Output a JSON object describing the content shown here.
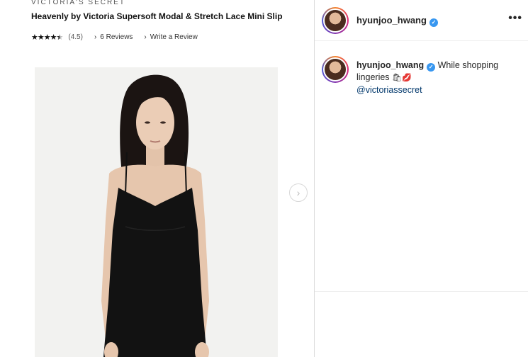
{
  "product": {
    "brand": "VICTORIA'S SECRET",
    "title": "Heavenly by Victoria Supersoft Modal & Stretch Lace Mini Slip",
    "rating": 4.5,
    "rating_text": "(4.5)",
    "reviews_link": "6 Reviews",
    "write_review_link": "Write a Review"
  },
  "post": {
    "header_username": "hyunjoo_hwang",
    "more_label": "•••",
    "caption_username": "hyunjoo_hwang",
    "caption_text": "While shopping lingeries",
    "caption_emoji": "🛍💋",
    "mention": "@victoriassecret"
  },
  "icons": {
    "next": "chevron-right-icon",
    "verified": "verified-badge-icon",
    "star": "star-icon"
  },
  "colors": {
    "verified_blue": "#3897f0",
    "mention": "#00376b",
    "divider": "#dbdbdb"
  }
}
